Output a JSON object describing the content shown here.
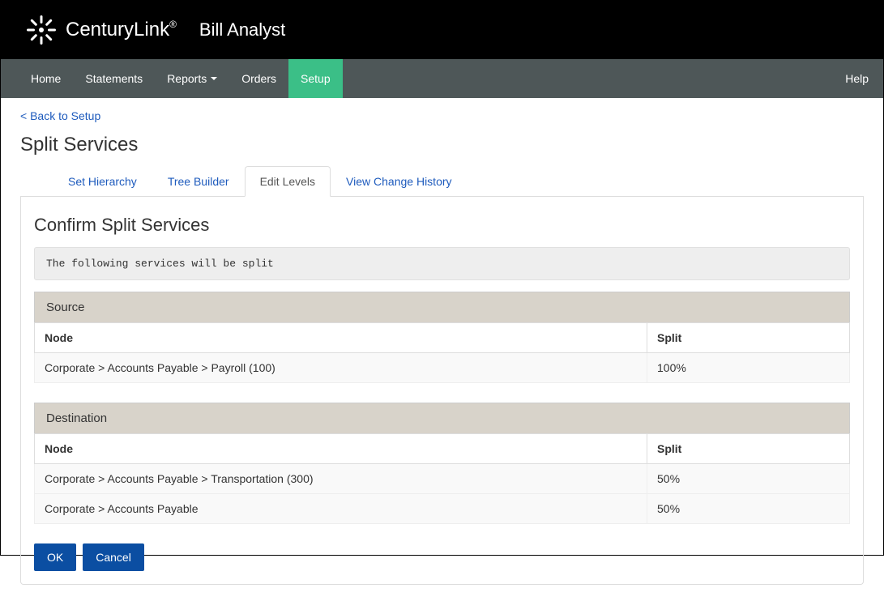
{
  "header": {
    "brand": "CenturyLink",
    "brand_suffix": "®",
    "app": "Bill Analyst"
  },
  "nav": {
    "items": [
      {
        "label": "Home",
        "active": false,
        "dropdown": false
      },
      {
        "label": "Statements",
        "active": false,
        "dropdown": false
      },
      {
        "label": "Reports",
        "active": false,
        "dropdown": true
      },
      {
        "label": "Orders",
        "active": false,
        "dropdown": false
      },
      {
        "label": "Setup",
        "active": true,
        "dropdown": false
      }
    ],
    "help": "Help"
  },
  "back_link": "< Back to Setup",
  "page_title": "Split Services",
  "tabs": [
    {
      "label": "Set Hierarchy",
      "active": false
    },
    {
      "label": "Tree Builder",
      "active": false
    },
    {
      "label": "Edit Levels",
      "active": true
    },
    {
      "label": "View Change History",
      "active": false
    }
  ],
  "section_title": "Confirm Split Services",
  "info_text": "The following services will be split",
  "source": {
    "title": "Source",
    "columns": {
      "node": "Node",
      "split": "Split"
    },
    "rows": [
      {
        "node": "Corporate > Accounts Payable > Payroll (100)",
        "split": "100%"
      }
    ]
  },
  "destination": {
    "title": "Destination",
    "columns": {
      "node": "Node",
      "split": "Split"
    },
    "rows": [
      {
        "node": "Corporate > Accounts Payable > Transportation (300)",
        "split": "50%"
      },
      {
        "node": "Corporate > Accounts Payable",
        "split": "50%"
      }
    ]
  },
  "buttons": {
    "ok": "OK",
    "cancel": "Cancel"
  }
}
